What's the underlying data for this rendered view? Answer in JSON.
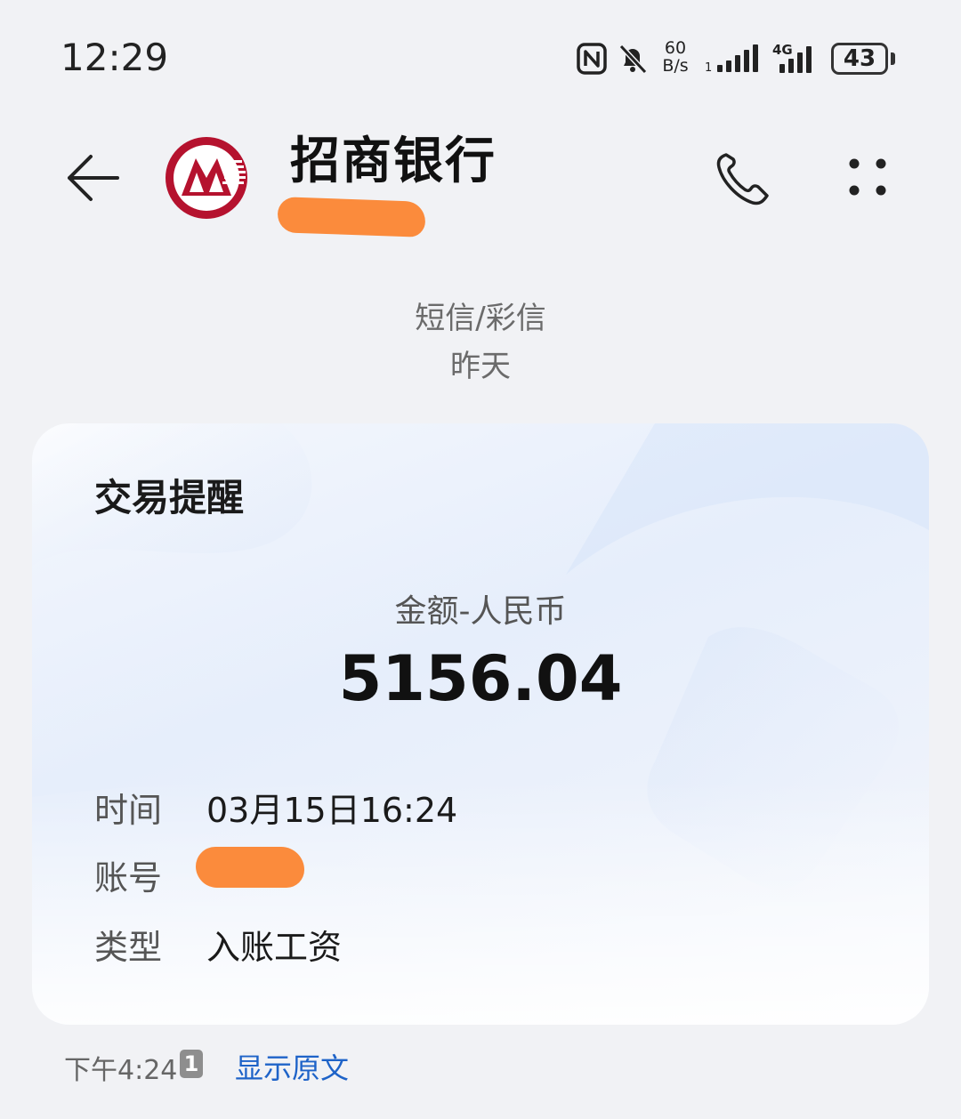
{
  "status_bar": {
    "time": "12:29",
    "net_speed_value": "60",
    "net_speed_unit": "B/s",
    "network": "4G",
    "battery": "43"
  },
  "header": {
    "title": "招商银行"
  },
  "conversation": {
    "message_type": "短信/彩信",
    "date": "昨天"
  },
  "card": {
    "title": "交易提醒",
    "amount_label": "金额-人民币",
    "amount_value": "5156.04",
    "rows": [
      {
        "label": "时间",
        "value": "03月15日16:24"
      },
      {
        "label": "账号",
        "value": ""
      },
      {
        "label": "类型",
        "value": "入账工资"
      }
    ]
  },
  "footer": {
    "time": "下午4:24",
    "sim": "1",
    "show_original": "显示原文"
  },
  "colors": {
    "brand_red": "#b5122e",
    "redaction": "#fb8b3c",
    "link_blue": "#1e63c8"
  }
}
